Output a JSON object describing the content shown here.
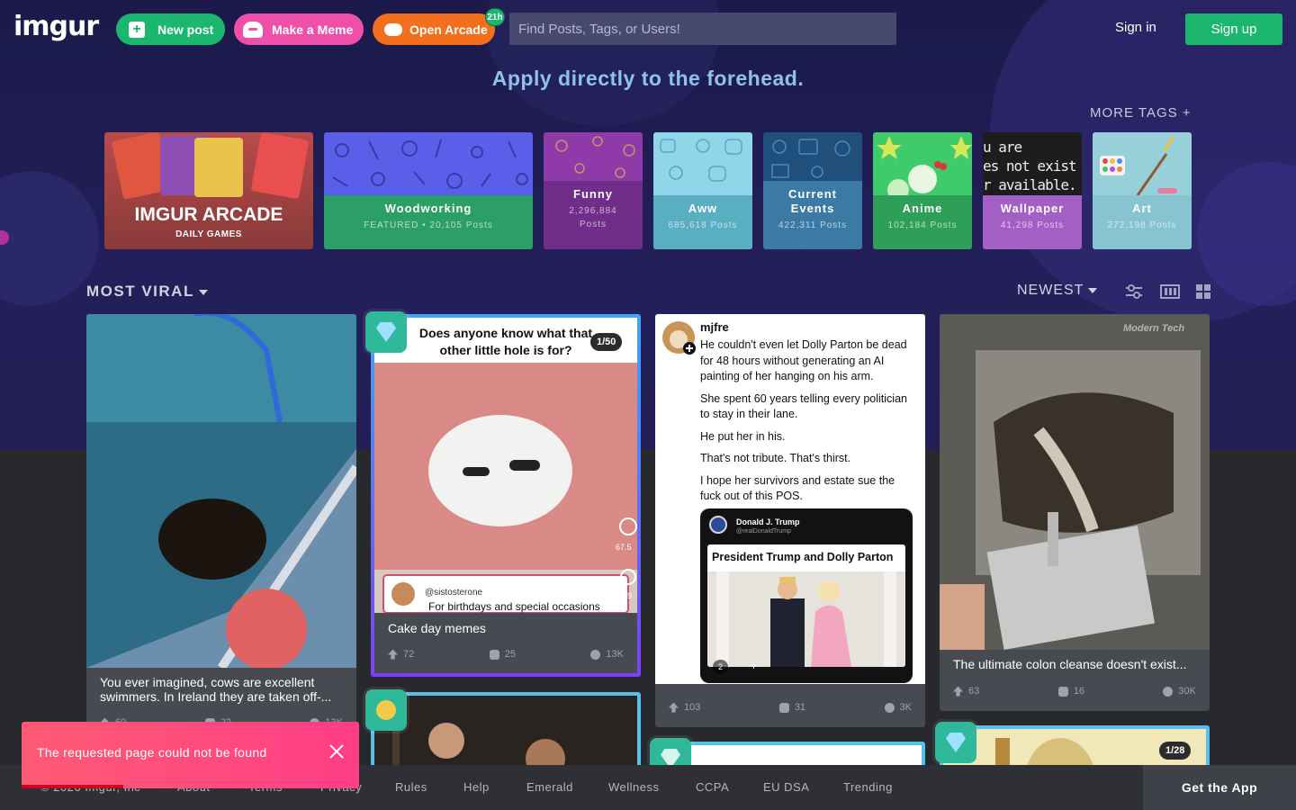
{
  "header": {
    "logo": "imgur",
    "new_post": "New post",
    "make_meme": "Make a Meme",
    "open_arcade": "Open Arcade",
    "arcade_badge": "21h",
    "search_placeholder": "Find Posts, Tags, or Users!",
    "sign_in": "Sign in",
    "sign_up": "Sign up"
  },
  "tagline": "Apply directly to the forehead.",
  "more_tags": "MORE TAGS +",
  "tags": [
    {
      "name": "IMGUR ARCADE",
      "sub": "DAILY GAMES"
    },
    {
      "name": "Woodworking",
      "sub": "FEATURED • 20,105 Posts"
    },
    {
      "name": "Funny",
      "sub1": "2,296,884",
      "sub2": "Posts"
    },
    {
      "name": "Aww",
      "sub": "685,618 Posts"
    },
    {
      "name1": "Current",
      "name2": "Events",
      "sub": "422,311 Posts"
    },
    {
      "name": "Anime",
      "sub": "102,184 Posts"
    },
    {
      "name": "Wallpaper",
      "sub": "41,298 Posts",
      "image_text": [
        "u are",
        "es not exist",
        "r available."
      ]
    },
    {
      "name": "Art",
      "sub": "272,198 Posts"
    }
  ],
  "sort": {
    "section": "MOST VIRAL",
    "order": "NEWEST",
    "icons": [
      "filter-icon",
      "list-view-icon",
      "grid-view-icon"
    ]
  },
  "posts": [
    {
      "title": "You ever imagined, cows are excellent swimmers. In Ireland they are taken off-...",
      "ups": "60",
      "comments": "22",
      "views": "13K"
    },
    {
      "title": "Cake day memes",
      "ups": "72",
      "comments": "25",
      "views": "13K",
      "counter": "1/50",
      "image_caption1": "Does anyone know what that",
      "image_caption2": "other little hole is for?",
      "image_handle": "@sistosterone",
      "image_comment": "For birthdays and special occasions",
      "image_likes": "67.5",
      "image_comments": "49"
    },
    {
      "user": "mjfre",
      "ups": "103",
      "comments": "31",
      "views": "3K",
      "lines": [
        "He couldn't even let Dolly Parton be dead for 48 hours without generating an AI painting of her hanging on his arm.",
        "She spent 60 years telling every politician to stay in their lane.",
        "He put her in his.",
        "That's not tribute. That's thirst.",
        "I hope her survivors and estate sue the fuck out of this POS."
      ],
      "embed_name": "Donald J. Trump",
      "embed_handle": "@realDonaldTrump",
      "embed_title": "President Trump and Dolly Parton",
      "embed_count": "2"
    },
    {
      "title": "The ultimate colon cleanse doesn't exist...",
      "ups": "63",
      "comments": "16",
      "views": "30K",
      "watermark": "Modern Tech"
    },
    {
      "counter": "1/28"
    }
  ],
  "footer": {
    "copyright": "© 2026 Imgur, Inc",
    "links": [
      "About",
      "Terms",
      "Privacy",
      "Rules",
      "Help",
      "Emerald",
      "Wellness",
      "CCPA",
      "EU DSA",
      "Trending"
    ],
    "get_app": "Get the App"
  },
  "toast": {
    "message": "The requested page could not be found",
    "progress": 0.3
  },
  "colors": {
    "green": "#1bb76e",
    "pink": "#ee4fa9",
    "orange": "#f36f1e",
    "tagline": "#8fc2ea",
    "toast": "#ff4a7c"
  }
}
